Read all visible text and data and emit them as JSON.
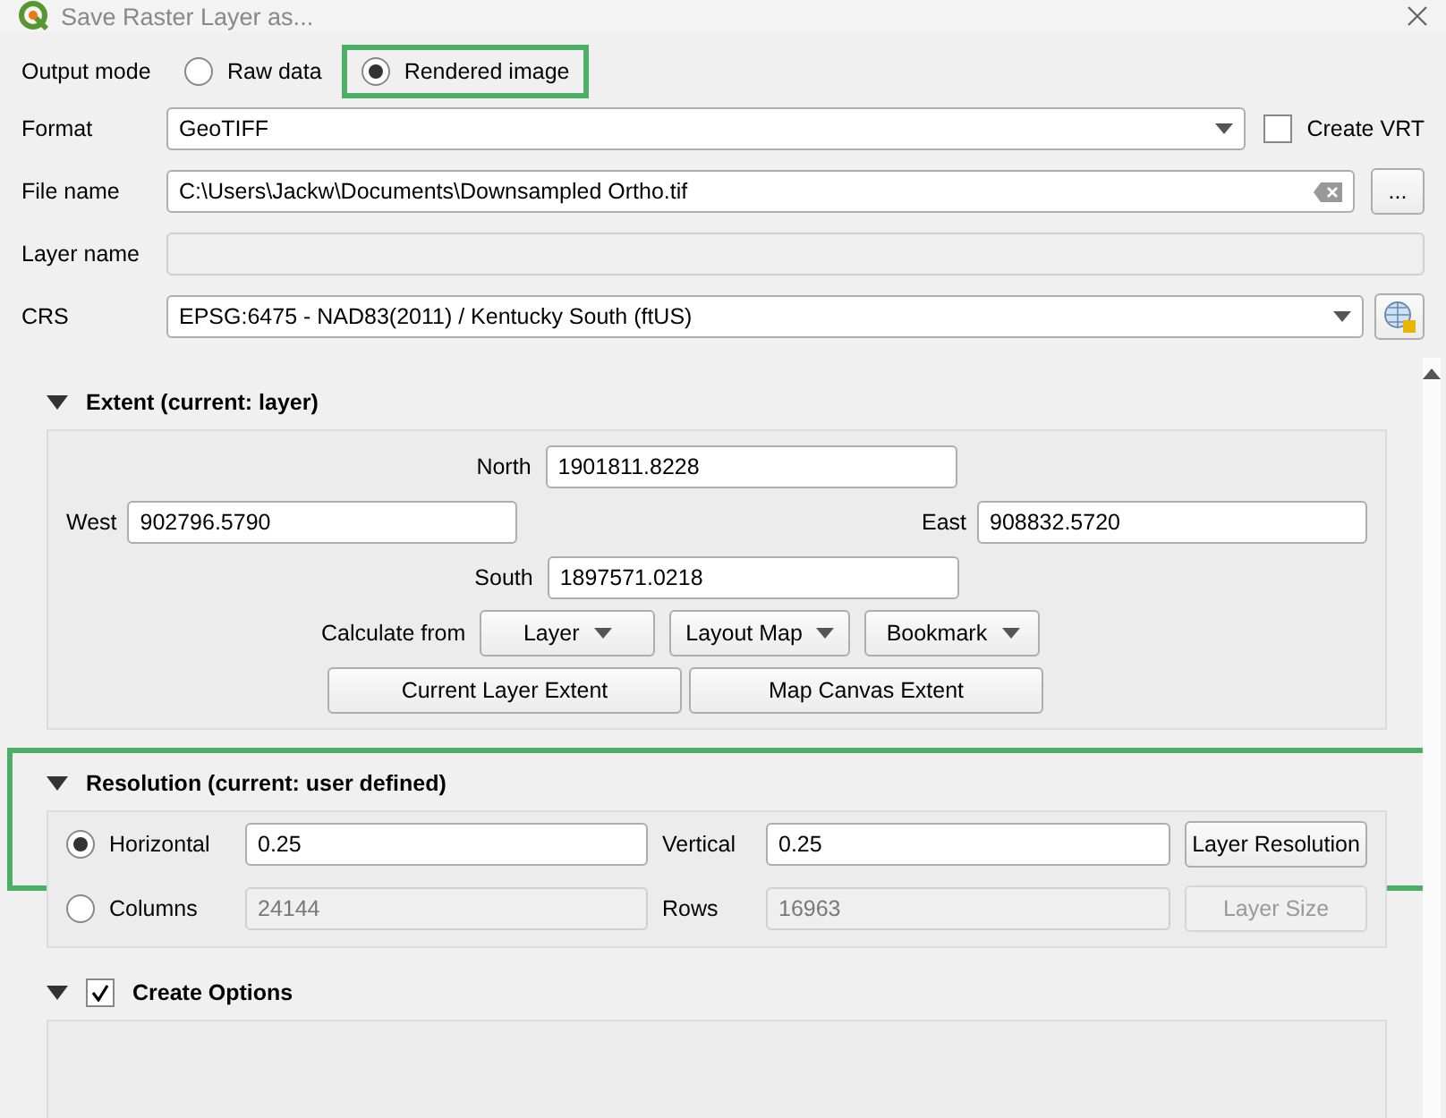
{
  "window": {
    "title": "Save Raster Layer as..."
  },
  "output_mode": {
    "label": "Output mode",
    "options": [
      {
        "label": "Raw data",
        "selected": false,
        "highlighted": false
      },
      {
        "label": "Rendered image",
        "selected": true,
        "highlighted": true
      }
    ]
  },
  "format": {
    "label": "Format",
    "value": "GeoTIFF",
    "create_vrt": {
      "label": "Create VRT",
      "checked": false
    }
  },
  "file_name": {
    "label": "File name",
    "value": "C:\\Users\\Jackw\\Documents\\Downsampled Ortho.tif",
    "browse": "..."
  },
  "layer_name": {
    "label": "Layer name",
    "disabled": true
  },
  "crs": {
    "label": "CRS",
    "value": "EPSG:6475 - NAD83(2011) / Kentucky South (ftUS)"
  },
  "extent": {
    "title": "Extent (current: layer)",
    "expanded": true,
    "north": {
      "label": "North",
      "value": "1901811.8228"
    },
    "west": {
      "label": "West",
      "value": "902796.5790"
    },
    "east": {
      "label": "East",
      "value": "908832.5720"
    },
    "south": {
      "label": "South",
      "value": "1897571.0218"
    },
    "calculate_label": "Calculate from",
    "calculate_buttons": [
      "Layer",
      "Layout Map",
      "Bookmark"
    ],
    "buttons": [
      "Current Layer Extent",
      "Map Canvas Extent"
    ]
  },
  "resolution": {
    "title": "Resolution (current: user defined)",
    "expanded": true,
    "highlighted": true,
    "rows": [
      {
        "label": "Horizontal",
        "selected": true,
        "field1": "0.25",
        "label2": "Vertical",
        "field2": "0.25",
        "button": "Layer Resolution"
      },
      {
        "label": "Columns",
        "selected": false,
        "field1": "24144",
        "label2": "Rows",
        "field2": "16963",
        "button": "Layer Size"
      }
    ]
  },
  "create_options": {
    "title": "Create Options",
    "expanded": true,
    "checked": true
  }
}
